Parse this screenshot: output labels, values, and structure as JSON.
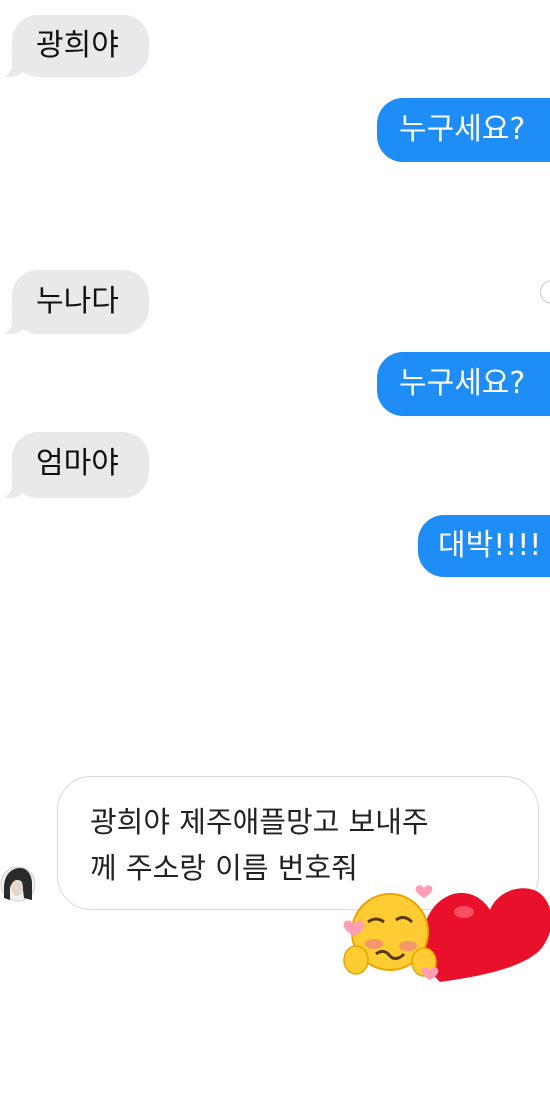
{
  "conversation": {
    "messages": [
      {
        "direction": "received",
        "text": "광희야"
      },
      {
        "direction": "sent",
        "text": "누구세요?"
      },
      {
        "direction": "received",
        "text": "누나다"
      },
      {
        "direction": "sent",
        "text": "누구세요?"
      },
      {
        "direction": "received",
        "text": "엄마야"
      },
      {
        "direction": "sent",
        "text": "대박!!!!"
      }
    ],
    "story_reply": {
      "line1": "광희야 제주애플망고 보내주",
      "line2": "께 주소랑 이름 번호줘"
    },
    "stickers": [
      "woozy-hugging-face-emoji",
      "red-heart-emoji"
    ]
  },
  "colors": {
    "sent_bubble": "#1e8df5",
    "received_bubble": "#e9e9eb",
    "heart": "#e8102b"
  }
}
